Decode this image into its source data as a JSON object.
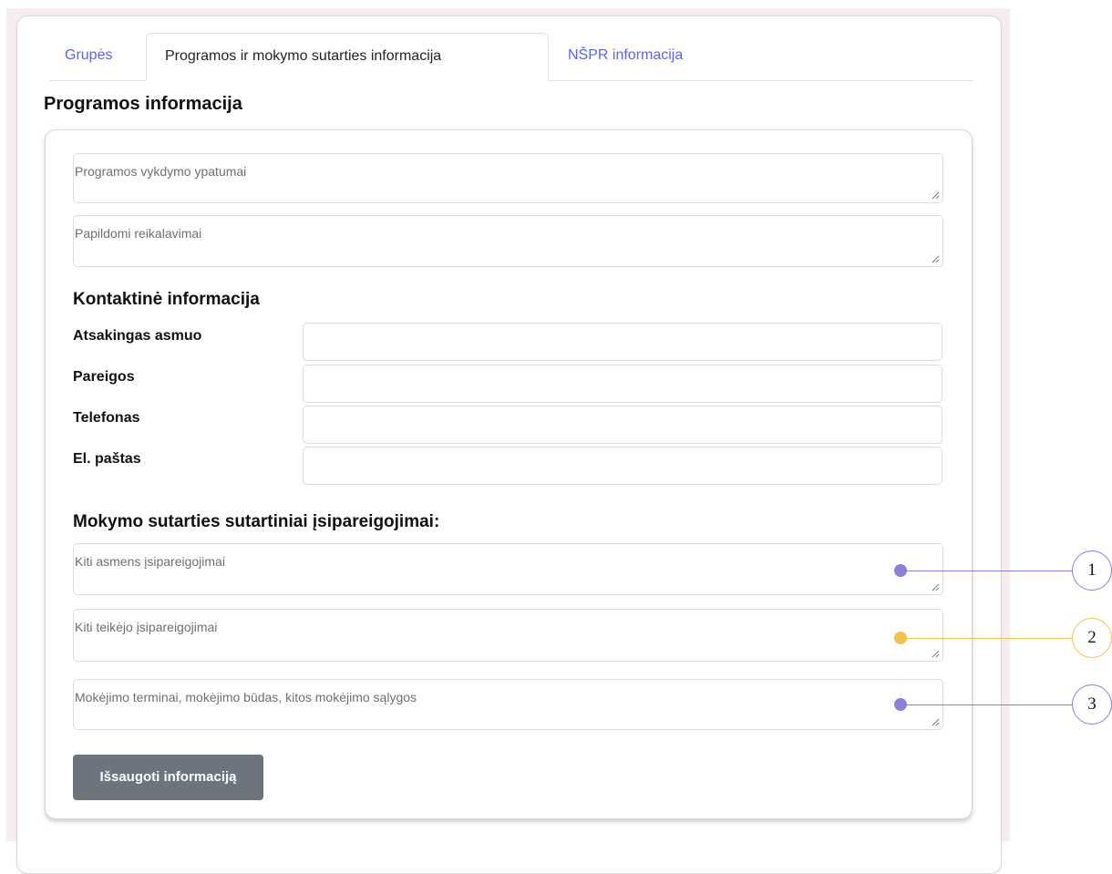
{
  "tabs": [
    {
      "label": "Grupės",
      "active": false
    },
    {
      "label": "Programos ir mokymo sutarties informacija",
      "active": true
    },
    {
      "label": "NŠPR informacija",
      "active": false
    }
  ],
  "section_title": "Programos informacija",
  "program_fields": {
    "execution_features_placeholder": "Programos vykdymo ypatumai",
    "additional_requirements_placeholder": "Papildomi reikalavimai"
  },
  "contact": {
    "heading": "Kontaktinė informacija",
    "responsible_person_label": "Atsakingas asmuo",
    "position_label": "Pareigos",
    "phone_label": "Telefonas",
    "email_label": "El. paštas"
  },
  "contract": {
    "heading": "Mokymo sutarties sutartiniai įsipareigojimai:",
    "person_obligations_placeholder": "Kiti asmens įsipareigojimai",
    "provider_obligations_placeholder": "Kiti teikėjo įsipareigojimai",
    "payment_terms_placeholder": "Mokėjimo terminai, mokėjimo būdas, kitos mokėjimo sąlygos"
  },
  "save_button_label": "Išsaugoti informaciją",
  "callouts": [
    {
      "number": "1",
      "color": "#8b7fdc"
    },
    {
      "number": "2",
      "color": "#f2c14b"
    },
    {
      "number": "3",
      "color": "#8b7fdc"
    }
  ],
  "colors": {
    "tab_link": "#5b63f1",
    "button": "#6c757d",
    "page_background": "#f6eeee"
  }
}
